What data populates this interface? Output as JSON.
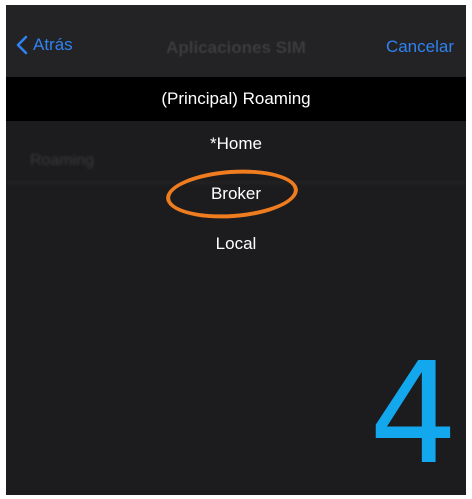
{
  "nav": {
    "back_label": "Atrás",
    "title": "Aplicaciones SIM",
    "cancel_label": "Cancelar"
  },
  "background_list": {
    "rows": [
      "Roaming"
    ]
  },
  "picker": {
    "header": "(Principal) Roaming",
    "options": [
      "*Home",
      "Broker",
      "Local"
    ],
    "highlighted_option": "Broker"
  },
  "annotation": {
    "step": "4",
    "ring_color": "#ef7d1f",
    "step_color": "#13a7ee"
  },
  "colors": {
    "accent": "#2f82f0",
    "background": "#1c1c1e"
  },
  "icons": {
    "back": "chevron-left-icon"
  }
}
